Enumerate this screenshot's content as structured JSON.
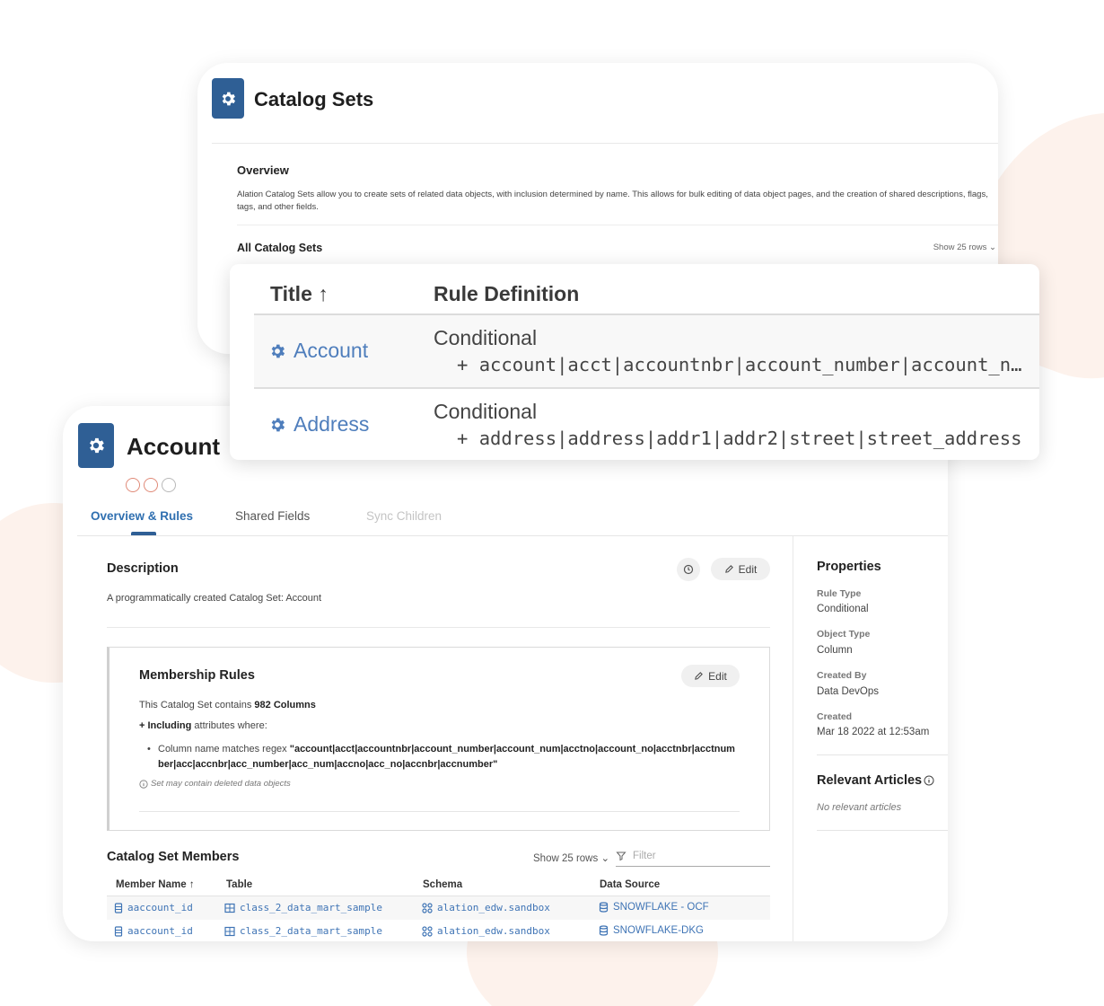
{
  "catalog_sets": {
    "title": "Catalog Sets",
    "overview_heading": "Overview",
    "overview_text": "Alation Catalog Sets allow you to create sets of related data objects, with inclusion determined by name. This allows for bulk editing of data object pages, and the creation of shared descriptions, flags, tags, and other fields.",
    "all_heading": "All Catalog Sets",
    "show_rows": "Show 25 rows"
  },
  "zoom_table": {
    "col_title": "Title",
    "col_rule": "Rule Definition",
    "rows": [
      {
        "title": "Account",
        "rule_type": "Conditional",
        "rule": "account|acct|accountnbr|account_number|account_num"
      },
      {
        "title": "Address",
        "rule_type": "Conditional",
        "rule": "address|address|addr1|addr2|street|street_address"
      }
    ]
  },
  "account": {
    "title": "Account",
    "tabs": [
      "Overview & Rules",
      "Shared Fields",
      "Sync Children"
    ],
    "description_heading": "Description",
    "edit_label": "Edit",
    "description_text": "A programmatically created Catalog Set: Account",
    "membership": {
      "heading": "Membership Rules",
      "edit_label": "Edit",
      "contains_prefix": "This Catalog Set contains ",
      "contains_count": "982 Columns",
      "including_bold": "+ Including",
      "including_rest": " attributes where:",
      "rule_prefix": "Column name matches regex ",
      "rule_regex": "\"account|acct|accountnbr|account_number|account_num|acctno|account_no|acctnbr|acctnumber|acc|accnbr|acc_number|acc_num|accno|acc_no|accnbr|accnumber\"",
      "note": "Set may contain deleted data objects"
    },
    "members": {
      "heading": "Catalog Set Members",
      "show_rows": "Show 25 rows",
      "filter_placeholder": "Filter",
      "columns": [
        "Member Name",
        "Table",
        "Schema",
        "Data Source"
      ],
      "rows": [
        {
          "name": "aaccount_id",
          "table": "class_2_data_mart_sample",
          "schema": "alation_edw.sandbox",
          "source": "SNOWFLAKE - OCF"
        },
        {
          "name": "aaccount_id",
          "table": "class_2_data_mart_sample",
          "schema": "alation_edw.sandbox",
          "source": "SNOWFLAKE-DKG"
        }
      ]
    },
    "properties": {
      "heading": "Properties",
      "items": [
        {
          "label": "Rule Type",
          "value": "Conditional"
        },
        {
          "label": "Object Type",
          "value": "Column"
        },
        {
          "label": "Created By",
          "value": "Data DevOps"
        },
        {
          "label": "Created",
          "value": "Mar 18 2022 at 12:53am"
        }
      ],
      "relevant_heading": "Relevant Articles",
      "relevant_empty": "No relevant articles"
    }
  },
  "colors": {
    "brand_blue": "#2f5f95",
    "link_blue": "#3f74b5",
    "accent_peach": "#fdf2ec"
  }
}
